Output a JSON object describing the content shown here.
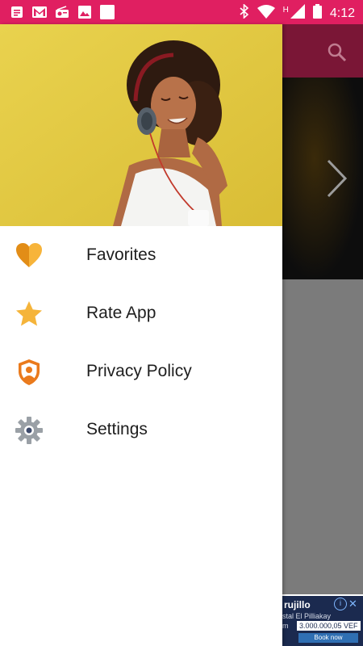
{
  "status_bar": {
    "time": "4:12",
    "network_label": "H",
    "left_icons": [
      "notes-icon",
      "gmail-icon",
      "radio-icon",
      "image-icon",
      "blank-icon"
    ],
    "right_icons": [
      "bluetooth-icon",
      "wifi-icon",
      "cell-signal-icon",
      "battery-icon"
    ]
  },
  "drawer": {
    "header_image": "woman-with-headphones",
    "items": [
      {
        "label": "Favorites",
        "icon": "heart-icon",
        "color": "#f0a628"
      },
      {
        "label": "Rate App",
        "icon": "star-icon",
        "color": "#f5b43a"
      },
      {
        "label": "Privacy Policy",
        "icon": "privacy-shield-icon",
        "color": "#ea7a1c"
      },
      {
        "label": "Settings",
        "icon": "gear-icon",
        "color": "#9aa0a6"
      }
    ]
  },
  "background_app": {
    "toolbar_color": "#7a1636",
    "ad": {
      "title": "rujillo",
      "subtitle": "stal El Pilliakay",
      "subtitle2": "m",
      "price": "3.000.000,05 VEF",
      "button": "Book now"
    }
  },
  "colors": {
    "status_bar": "#e01f61",
    "header_bg": "#e8cf48"
  }
}
